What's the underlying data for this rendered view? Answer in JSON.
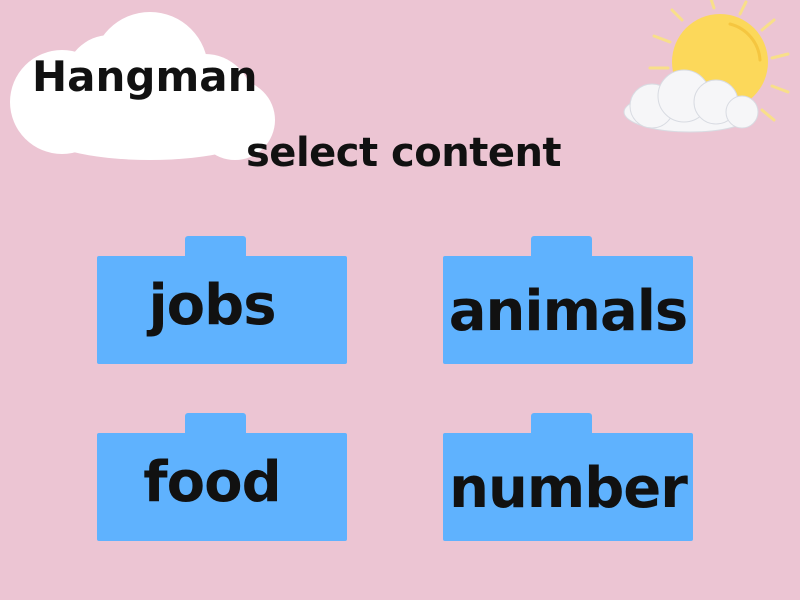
{
  "game": {
    "title": "Hangman",
    "subtitle": "select content",
    "categories": [
      {
        "label": "jobs"
      },
      {
        "label": "animals"
      },
      {
        "label": "food"
      },
      {
        "label": "number"
      }
    ]
  },
  "colors": {
    "background": "#ecc5d3",
    "folder": "#5fb2fe",
    "cloud": "#ffffff",
    "sun": "#fcd85a",
    "sun_rays": "#f8df8a",
    "text": "#111111"
  },
  "icons": {
    "title_cloud": "cloud-icon",
    "sun": "sun-with-cloud-icon"
  }
}
